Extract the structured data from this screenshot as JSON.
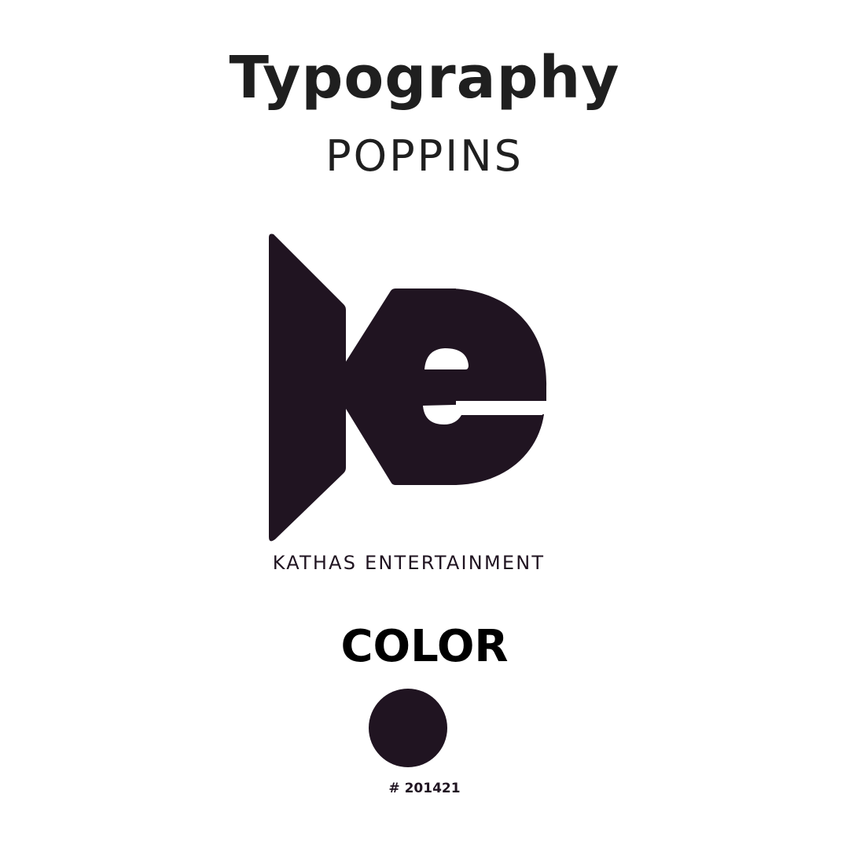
{
  "typography": {
    "title": "Typography",
    "font_name": "POPPINS"
  },
  "logo": {
    "icon": "ke-monogram-logo",
    "wordmark": "KATHAS ENTERTAINMENT"
  },
  "color": {
    "heading": "COLOR",
    "swatch_hex": "#201421",
    "label": "# 201421"
  }
}
